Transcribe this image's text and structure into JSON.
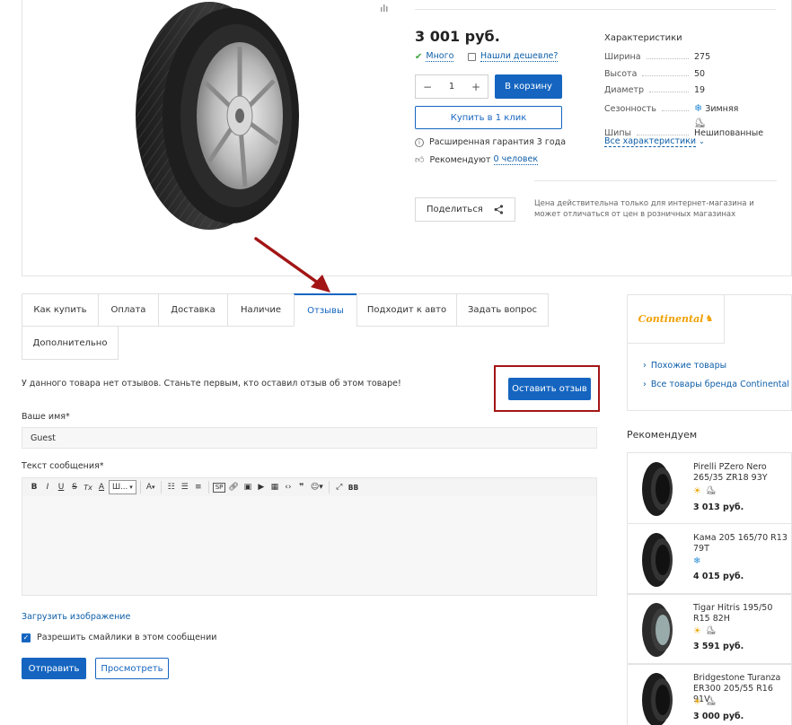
{
  "product": {
    "price": "3 001 руб.",
    "stock": "Много",
    "cheaper_link": "Нашли дешевле?",
    "quantity": "1",
    "minus": "−",
    "plus": "+",
    "cart_button": "В корзину",
    "one_click_button": "Купить в 1 клик",
    "warranty": "Расширенная гарантия 3 года",
    "recommend_prefix": "Рекомендуют",
    "recommend_link": "0 человек",
    "share_button": "Поделиться",
    "price_note": "Цена действительна только для интернет-магазина и может отличаться от цен в розничных магазинах"
  },
  "specs": {
    "title": "Характеристики",
    "rows": [
      {
        "label": "Ширина",
        "value": "275"
      },
      {
        "label": "Высота",
        "value": "50"
      },
      {
        "label": "Диаметр",
        "value": "19"
      },
      {
        "label": "Сезонность",
        "value": "Зимняя"
      },
      {
        "label": "Шипы",
        "value": "Нешипованные"
      }
    ],
    "all_link": "Все характеристики"
  },
  "tabs": [
    {
      "label": "Как купить"
    },
    {
      "label": "Оплата"
    },
    {
      "label": "Доставка"
    },
    {
      "label": "Наличие"
    },
    {
      "label": "Отзывы"
    },
    {
      "label": "Подходит к авто"
    },
    {
      "label": "Задать вопрос"
    },
    {
      "label": "Дополнительно"
    }
  ],
  "reviews": {
    "empty_text": "У данного товара нет отзывов. Станьте первым, кто оставил отзыв об этом товаре!",
    "leave_review_button": "Оставить отзыв",
    "name_label": "Ваше имя*",
    "name_value": "Guest",
    "message_label": "Текст сообщения*",
    "upload_link": "Загрузить изображение",
    "smileys_label": "Разрешить смайлики в этом сообщении",
    "submit_button": "Отправить",
    "preview_button": "Просмотреть"
  },
  "toolbar": {
    "bold": "B",
    "italic": "I",
    "underline": "U",
    "strike": "S",
    "clear": "Tx",
    "font_color": "A",
    "font_select": "Ш...",
    "font_size": "A",
    "bb": "BB",
    "quote": "❞"
  },
  "sidebar": {
    "brand": "Continental",
    "links": [
      "Похожие товары",
      "Все товары бренда Continental"
    ],
    "rec_title": "Рекомендуем",
    "items": [
      {
        "name": "Pirelli PZero Nero 265/35 ZR18 93Y",
        "price": "3 013 руб."
      },
      {
        "name": "Кама 205 165/70 R13 79T",
        "price": "4 015 руб."
      },
      {
        "name": "Tigar Hitris 195/50 R15 82H",
        "price": "3 591 руб."
      },
      {
        "name": "Bridgestone Turanza ER300 205/55 R16 91V",
        "price": "3 000 руб."
      }
    ]
  },
  "colors": {
    "accent": "#1565c0",
    "annotation": "#a31515",
    "check": "#3aa63a"
  }
}
